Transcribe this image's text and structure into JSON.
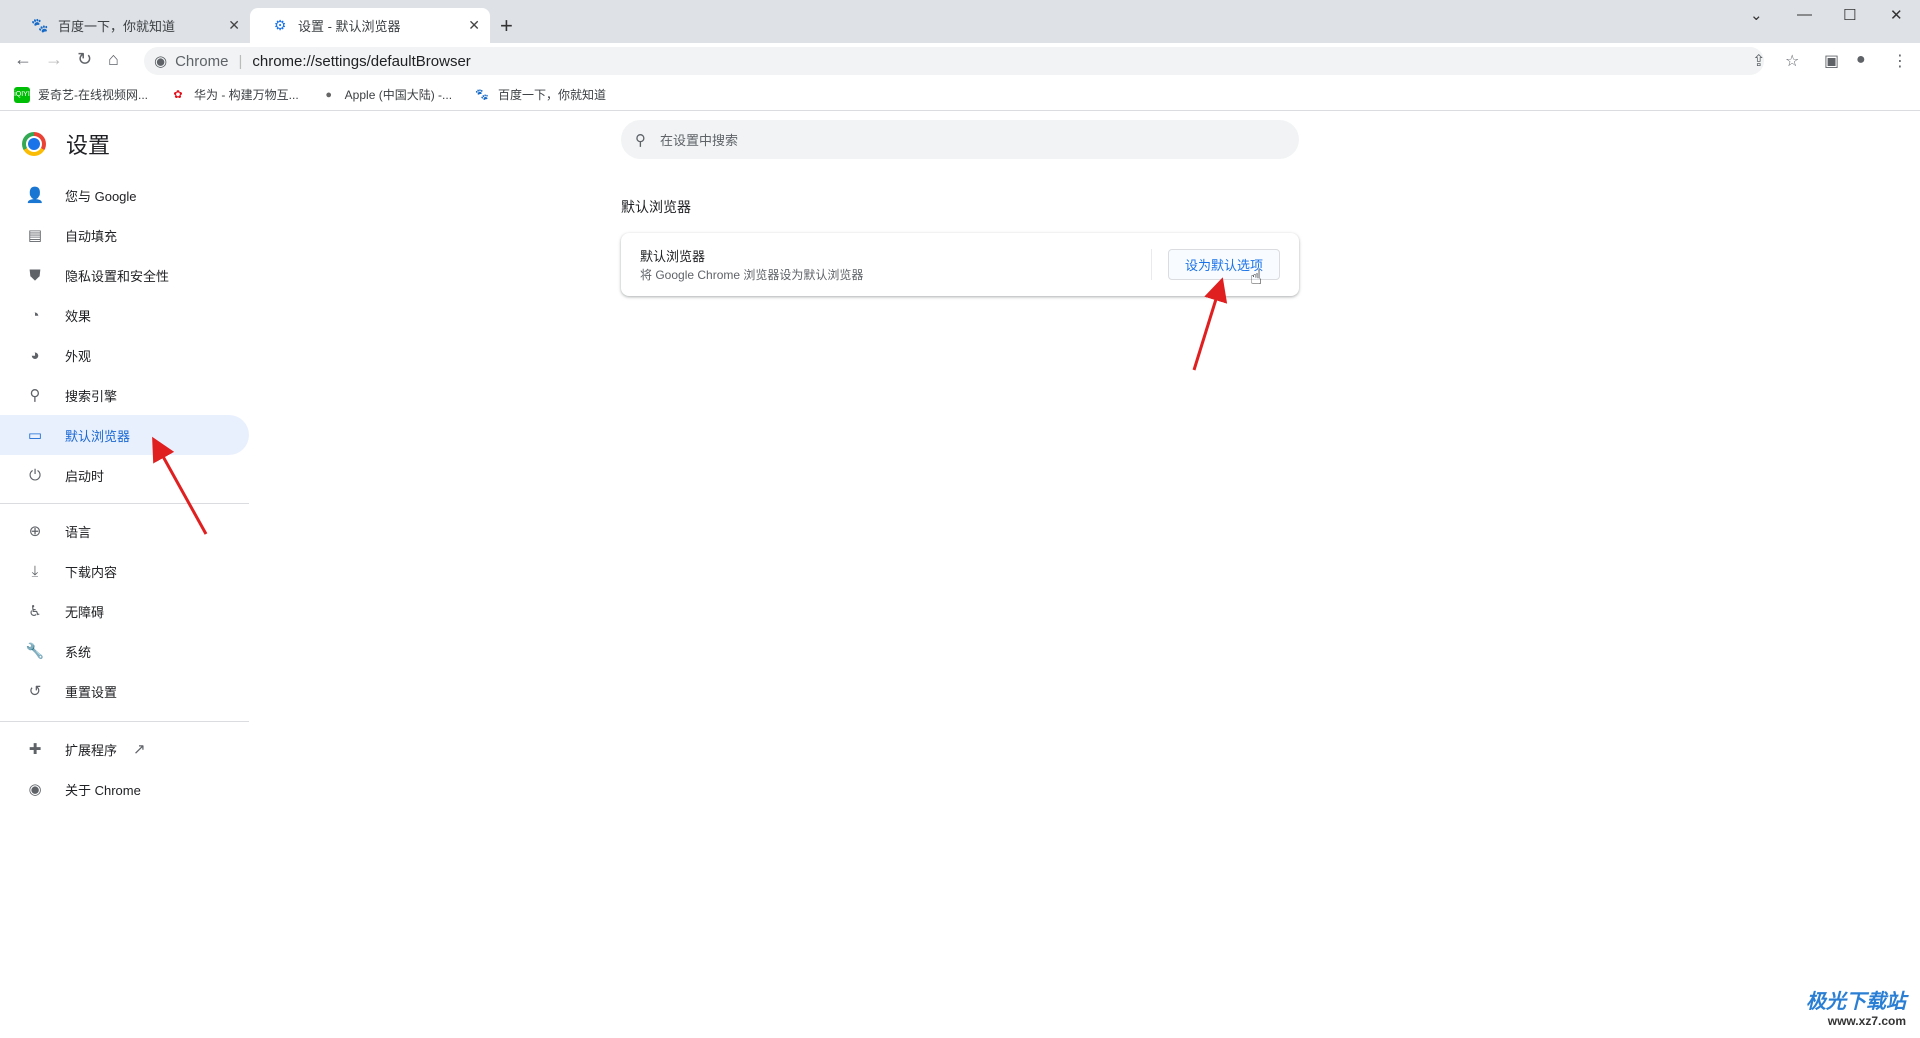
{
  "tabs": [
    {
      "label": "百度一下，你就知道",
      "icon": "baidu-paw-icon",
      "active": false
    },
    {
      "label": "设置 - 默认浏览器",
      "icon": "gear-icon",
      "active": true
    }
  ],
  "toolbar": {
    "site_label": "Chrome",
    "url": "chrome://settings/defaultBrowser"
  },
  "bookmarks": [
    {
      "label": "爱奇艺-在线视频网...",
      "icon": "iqiyi-icon"
    },
    {
      "label": "华为 - 构建万物互...",
      "icon": "huawei-icon"
    },
    {
      "label": "Apple (中国大陆) -...",
      "icon": "apple-icon"
    },
    {
      "label": "百度一下，你就知道",
      "icon": "baidu-paw-icon"
    }
  ],
  "sidebar": {
    "title": "设置",
    "items": [
      {
        "label": "您与 Google",
        "icon": "person-icon"
      },
      {
        "label": "自动填充",
        "icon": "clipboard-icon"
      },
      {
        "label": "隐私设置和安全性",
        "icon": "shield-icon"
      },
      {
        "label": "效果",
        "icon": "speedometer-icon"
      },
      {
        "label": "外观",
        "icon": "palette-icon"
      },
      {
        "label": "搜索引擎",
        "icon": "search-icon"
      },
      {
        "label": "默认浏览器",
        "icon": "browser-icon",
        "selected": true
      },
      {
        "label": "启动时",
        "icon": "power-icon"
      },
      {
        "label": "语言",
        "icon": "globe-icon"
      },
      {
        "label": "下载内容",
        "icon": "download-icon"
      },
      {
        "label": "无障碍",
        "icon": "accessibility-icon"
      },
      {
        "label": "系统",
        "icon": "wrench-icon"
      },
      {
        "label": "重置设置",
        "icon": "history-icon"
      },
      {
        "label": "扩展程序",
        "icon": "puzzle-icon"
      },
      {
        "label": "关于 Chrome",
        "icon": "chrome-icon"
      }
    ]
  },
  "main": {
    "search_placeholder": "在设置中搜索",
    "section_title": "默认浏览器",
    "card": {
      "title": "默认浏览器",
      "subtitle": "将 Google Chrome 浏览器设为默认浏览器",
      "button": "设为默认选项"
    }
  },
  "watermark": {
    "name": "极光下载站",
    "url": "www.xz7.com"
  },
  "colors": {
    "accent": "#1a73e8",
    "selected_bg": "#e8f0fe",
    "arrow": "#e02020"
  }
}
